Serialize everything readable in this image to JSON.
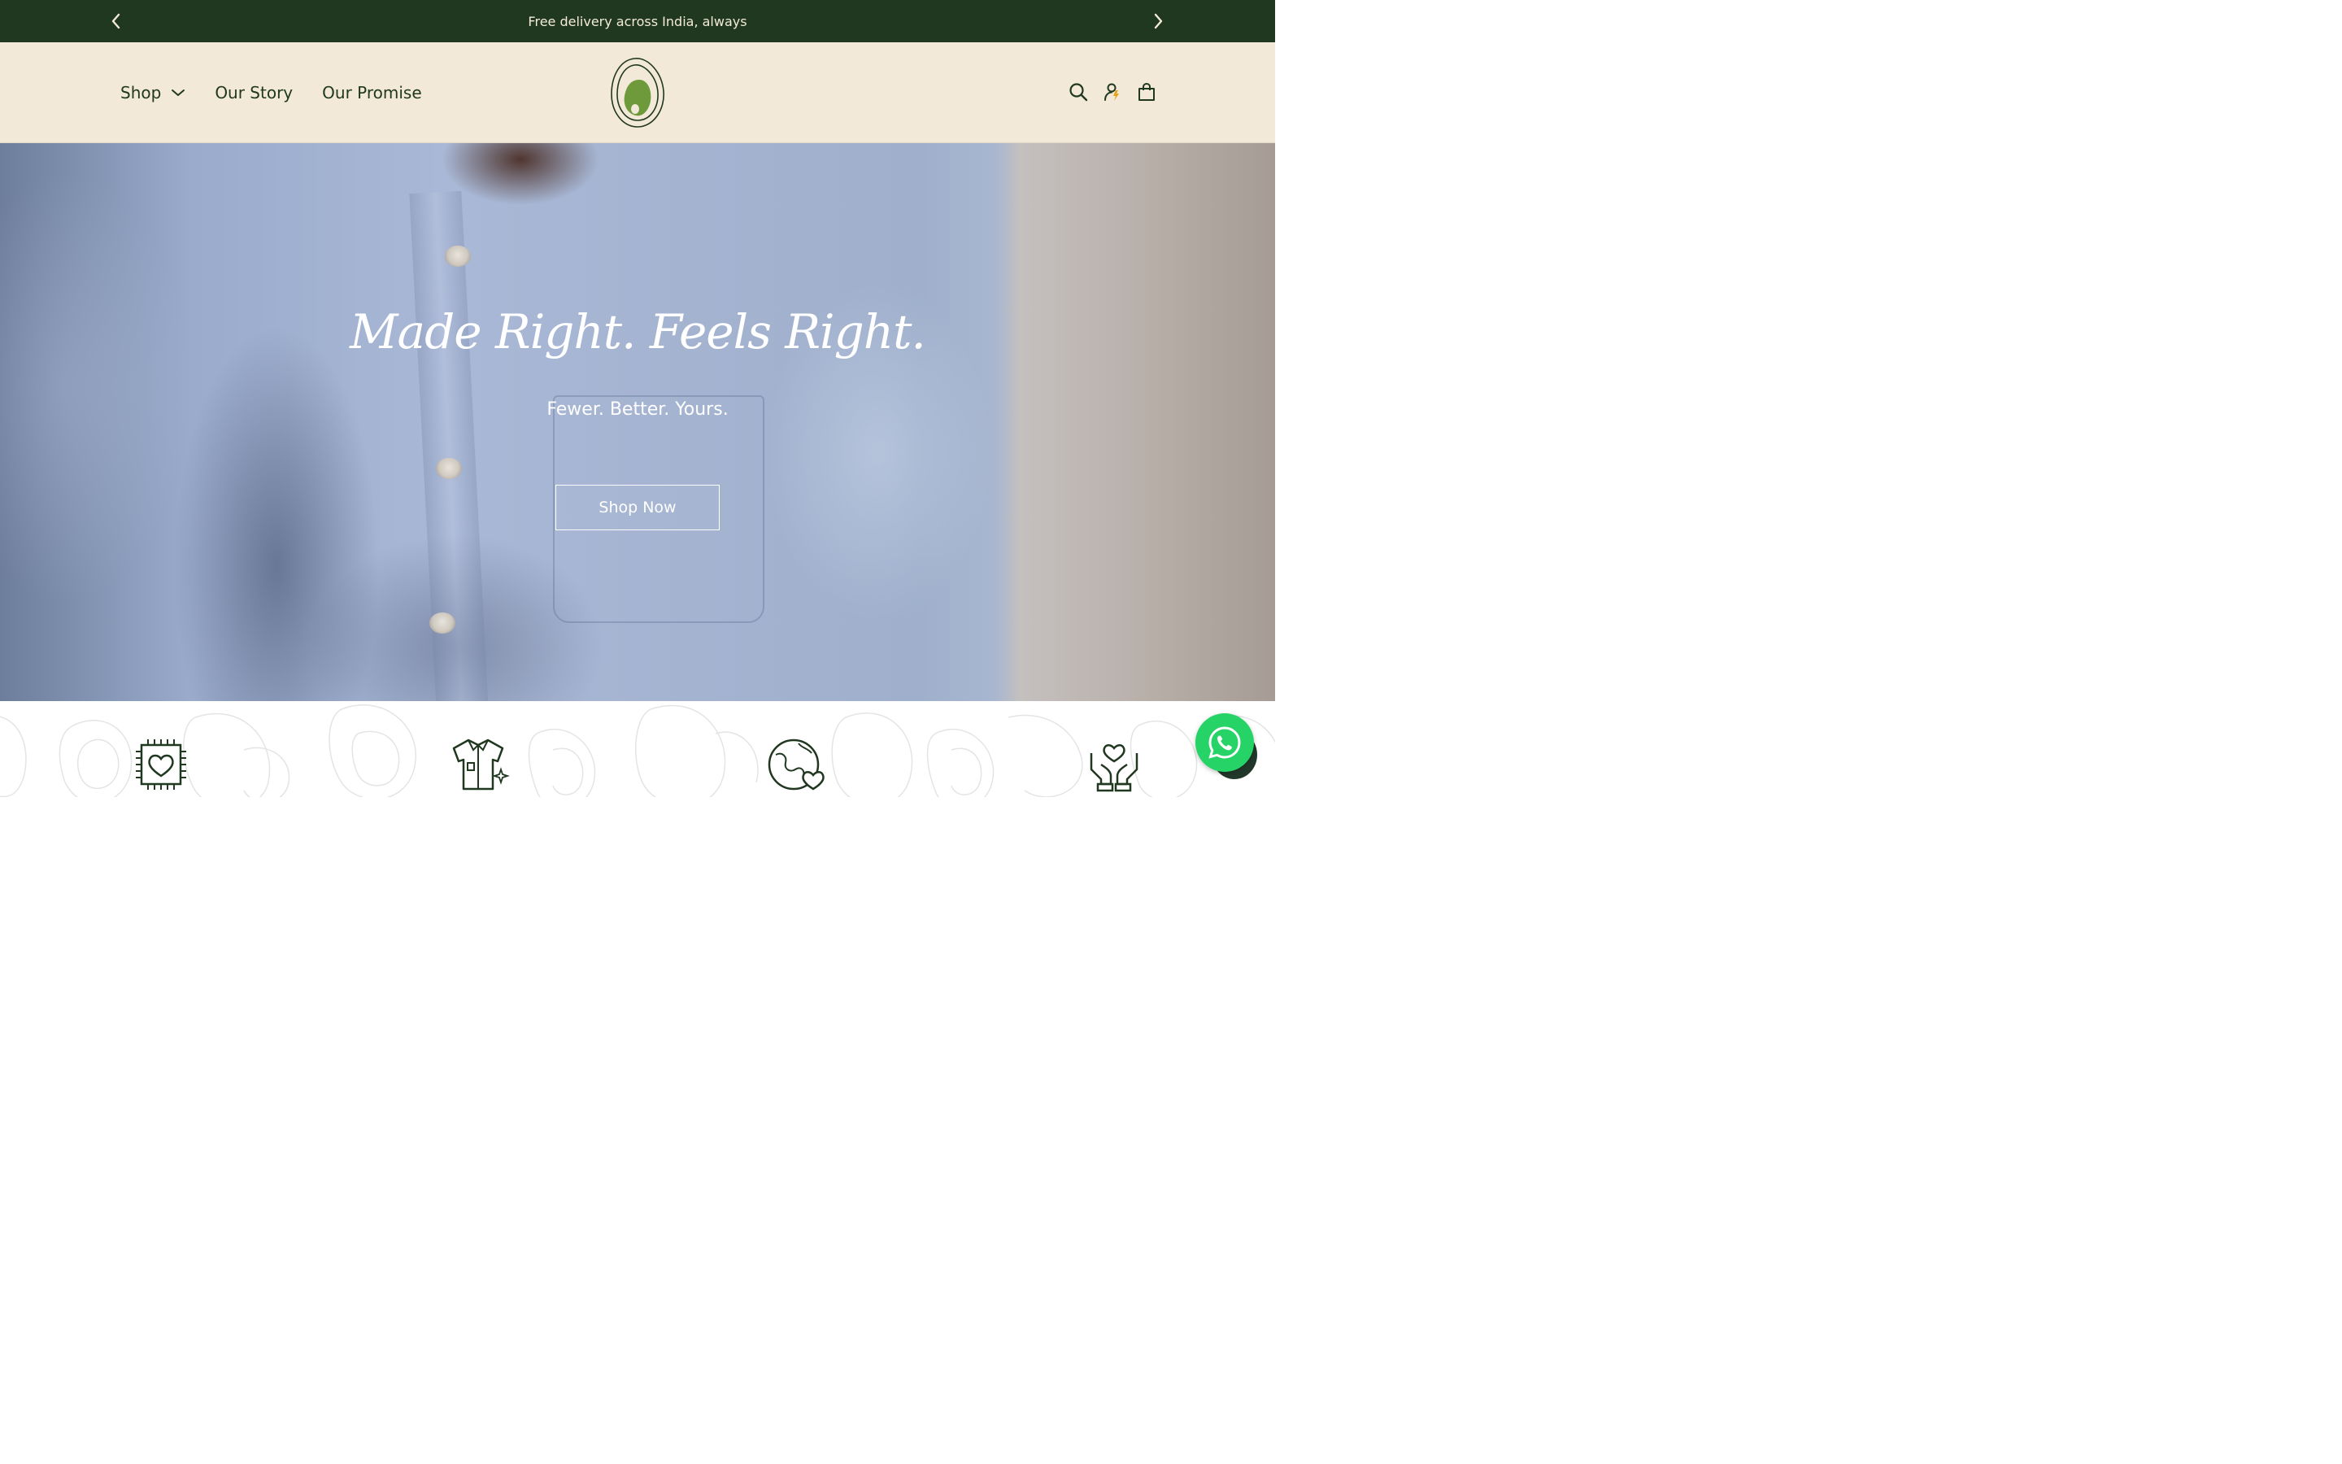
{
  "announcement": {
    "text": "Free delivery across India, always",
    "prev_icon": "chevron-left-icon",
    "next_icon": "chevron-right-icon"
  },
  "header": {
    "nav": [
      {
        "label": "Shop",
        "has_dropdown": true
      },
      {
        "label": "Our Story"
      },
      {
        "label": "Our Promise"
      }
    ],
    "logo_icon": "brand-logo-icon",
    "icons": [
      "search-icon",
      "account-icon",
      "cart-icon"
    ]
  },
  "hero": {
    "title": "Made Right. Feels Right.",
    "subtitle": "Fewer. Better. Yours.",
    "cta_label": "Shop Now"
  },
  "features": {
    "icons": [
      "heart-fabric-icon",
      "shirt-sparkle-icon",
      "globe-heart-icon",
      "hands-heart-icon"
    ]
  },
  "floating": {
    "whatsapp_icon": "whatsapp-icon"
  },
  "colors": {
    "announcement_bg": "#213820",
    "header_bg": "#f2e9d8",
    "brand_green": "#213820",
    "logo_fill": "#6f9a3c",
    "whatsapp": "#25d366"
  }
}
